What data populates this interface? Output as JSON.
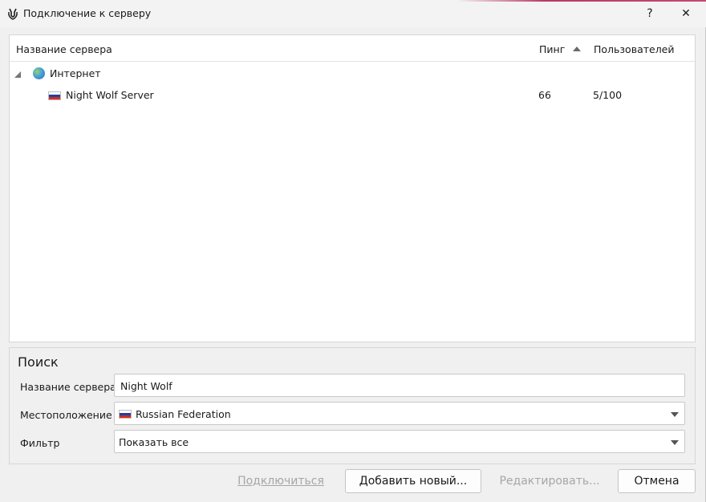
{
  "window": {
    "title": "Подключение к серверу",
    "help_label": "?",
    "close_label": "✕"
  },
  "tree": {
    "columns": {
      "name": "Название сервера",
      "ping": "Пинг",
      "users": "Пользователей"
    },
    "sort": {
      "column": "ping",
      "direction": "ascending"
    },
    "group": {
      "label": "Интернет",
      "icon": "globe-icon",
      "expanded": true
    },
    "servers": [
      {
        "flag": "russia-flag",
        "name": "Night Wolf Server",
        "ping": "66",
        "users": "5/100"
      }
    ]
  },
  "search": {
    "title": "Поиск",
    "server_name_label": "Название сервера",
    "server_name_value": "Night Wolf",
    "location_label": "Местоположение",
    "location_value": "Russian Federation",
    "filter_label": "Фильтр",
    "filter_value": "Показать все"
  },
  "buttons": {
    "connect": "Подключиться",
    "add_new": "Добавить новый...",
    "edit": "Редактировать...",
    "cancel": "Отмена"
  },
  "colors": {
    "accent": "#b83a62",
    "disabled_text": "#a6a6a6",
    "flag_white": "#ffffff",
    "flag_blue": "#1c3fa8",
    "flag_red": "#d52b1e"
  }
}
